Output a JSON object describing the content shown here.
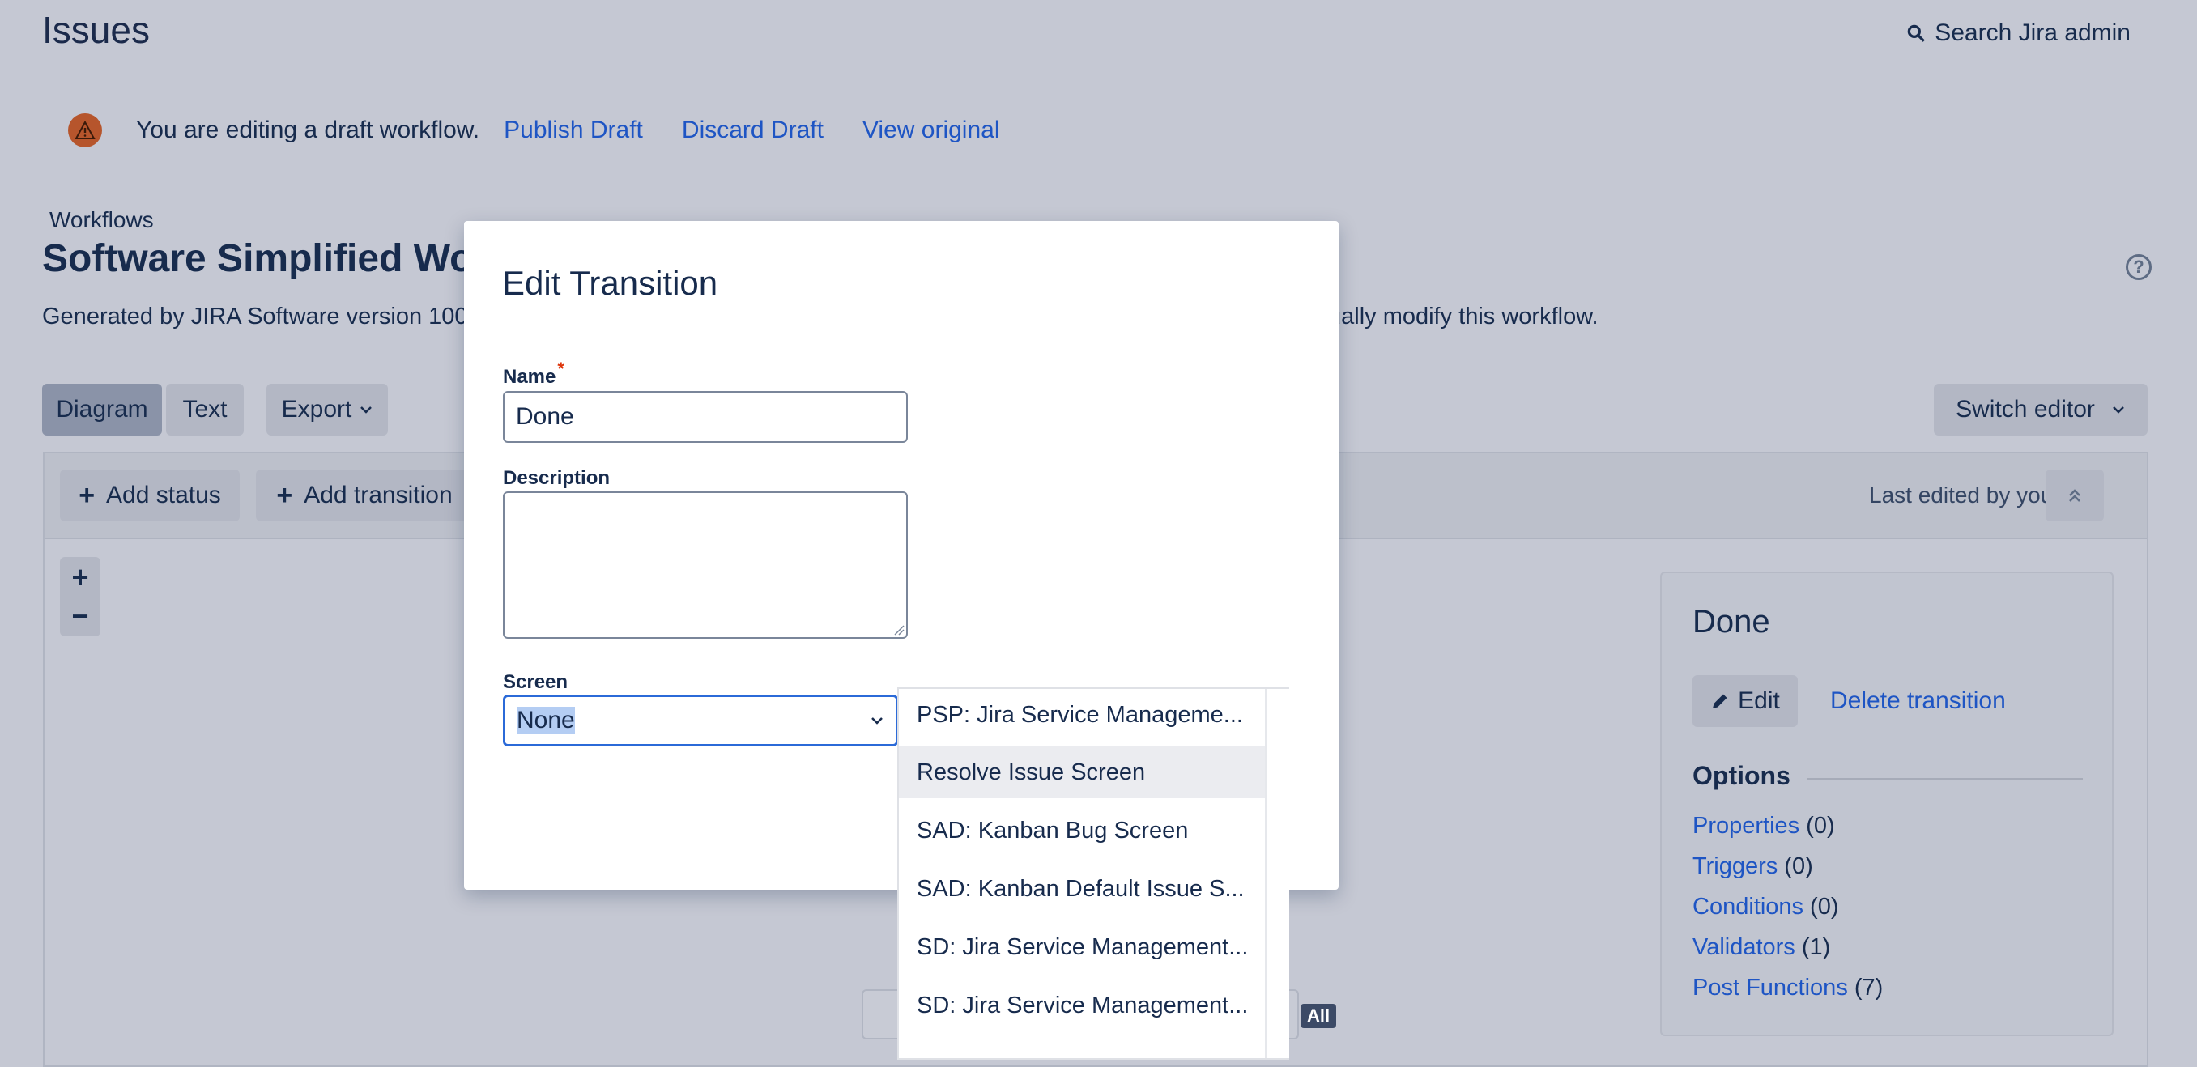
{
  "header": {
    "title": "Issues",
    "search_label": "Search Jira admin"
  },
  "draft_banner": {
    "message": "You are editing a draft workflow.",
    "publish": "Publish Draft",
    "discard": "Discard Draft",
    "view_original": "View original"
  },
  "workflow": {
    "breadcrumb": "Workflows",
    "title": "Software Simplified Work",
    "desc_left": "Generated by JIRA Software version 100",
    "desc_right": "ually modify this workflow."
  },
  "toolbar": {
    "tab_diagram": "Diagram",
    "tab_text": "Text",
    "export": "Export",
    "switch_editor": "Switch editor"
  },
  "canvas": {
    "add_status": "Add status",
    "add_transition": "Add transition",
    "last_edited": "Last edited by you,",
    "zoom_in": "+",
    "zoom_out": "−",
    "badge": "All"
  },
  "side_panel": {
    "title": "Done",
    "edit": "Edit",
    "delete": "Delete transition",
    "options_heading": "Options",
    "options": [
      {
        "label": "Properties",
        "count": "(0)"
      },
      {
        "label": "Triggers",
        "count": "(0)"
      },
      {
        "label": "Conditions",
        "count": "(0)"
      },
      {
        "label": "Validators",
        "count": "(1)"
      },
      {
        "label": "Post Functions",
        "count": "(7)"
      }
    ]
  },
  "modal": {
    "title": "Edit Transition",
    "name_label": "Name",
    "name_value": "Done",
    "description_label": "Description",
    "description_value": "",
    "screen_label": "Screen",
    "screen_value": "None"
  },
  "dropdown": {
    "items": [
      "PSP: Jira Service Manageme...",
      "Resolve Issue Screen",
      "SAD: Kanban Bug Screen",
      "SAD: Kanban Default Issue S...",
      "SD: Jira Service Management...",
      "SD: Jira Service Management..."
    ],
    "highlighted_index": 1
  },
  "colors": {
    "link": "#1e55c4",
    "background_overlay": "#c5c8d3",
    "focus": "#2b6ad8",
    "warning": "#b6552c"
  }
}
